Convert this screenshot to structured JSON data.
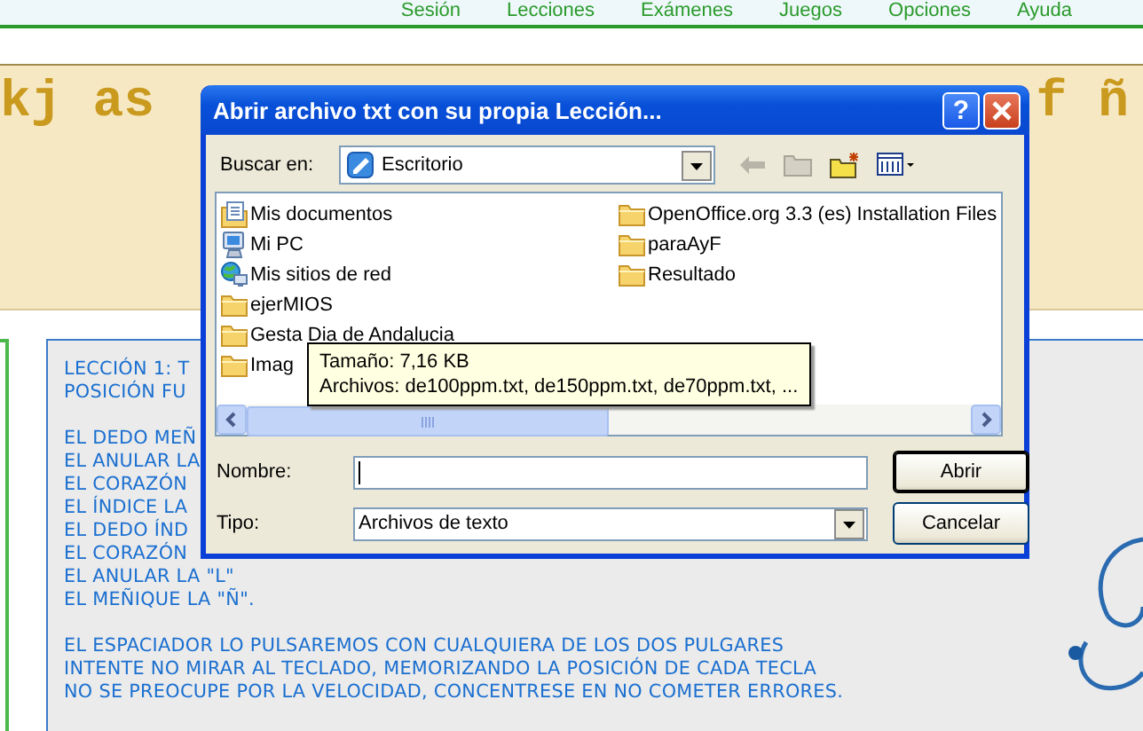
{
  "menu": [
    "Sesión",
    "Lecciones",
    "Exámenes",
    "Juegos",
    "Opciones",
    "Ayuda"
  ],
  "practice_line": [
    "kj as",
    "f ñ"
  ],
  "lesson": {
    "paragraphs": [
      [
        "LECCIÓN 1: T",
        "POSICIÓN FU"
      ],
      [
        "EL DEDO MEÑ",
        "EL ANULAR LA",
        "EL CORAZÓN",
        "EL ÍNDICE LA",
        "EL DEDO ÍND",
        "EL CORAZÓN",
        "EL ANULAR LA \"L\"",
        "EL MEÑIQUE LA \"Ñ\"."
      ],
      [
        "EL ESPACIADOR LO PULSAREMOS CON CUALQUIERA DE LOS DOS PULGARES",
        "INTENTE NO MIRAR AL TECLADO, MEMORIZANDO LA POSICIÓN DE CADA TECLA",
        "NO SE PREOCUPE POR LA VELOCIDAD, CONCENTRESE EN NO COMETER ERRORES."
      ]
    ]
  },
  "dialog": {
    "title": "Abrir archivo txt con su propia Lección...",
    "help_button": "?",
    "look_in": {
      "label": "Buscar en:",
      "value": "Escritorio"
    },
    "files": [
      {
        "name": "Mis documentos",
        "kind": "documents"
      },
      {
        "name": "Mi PC",
        "kind": "computer"
      },
      {
        "name": "Mis sitios de red",
        "kind": "network"
      },
      {
        "name": "ejerMIOS",
        "kind": "folder"
      },
      {
        "name": "Gesta Dia de Andalucia",
        "kind": "folder"
      },
      {
        "name": "Imag",
        "kind": "folder"
      },
      {
        "name": "OpenOffice.org 3.3 (es) Installation Files",
        "kind": "folder"
      },
      {
        "name": "paraAyF",
        "kind": "folder"
      },
      {
        "name": "Resultado",
        "kind": "folder"
      }
    ],
    "tooltip": [
      "Tamaño: 7,16 KB",
      "Archivos: de100ppm.txt, de150ppm.txt, de70ppm.txt, ..."
    ],
    "name_field": {
      "label": "Nombre:"
    },
    "type_field": {
      "label": "Tipo:",
      "value": "Archivos de texto"
    },
    "buttons": [
      {
        "label": "Abrir",
        "default": true
      },
      {
        "label": "Cancelar",
        "default": false
      }
    ]
  }
}
